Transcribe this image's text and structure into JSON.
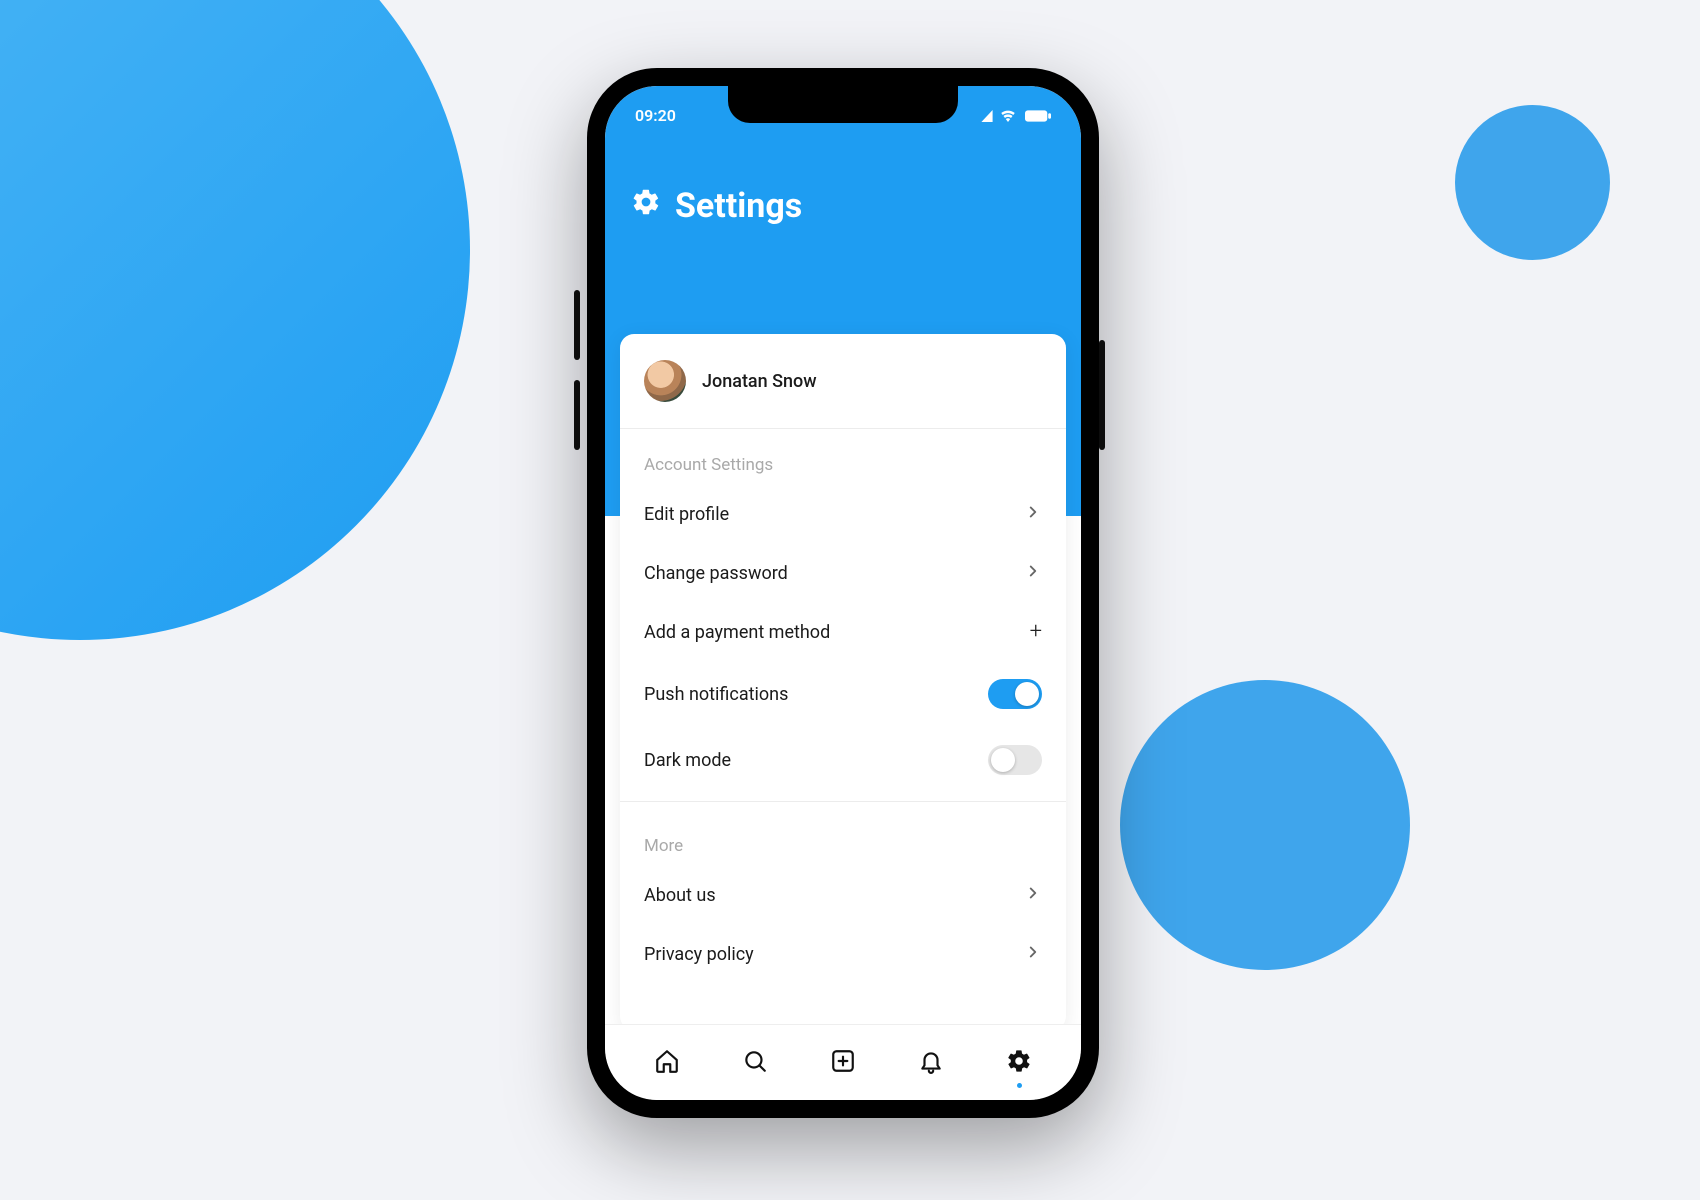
{
  "status": {
    "time": "09:20"
  },
  "page": {
    "title": "Settings"
  },
  "profile": {
    "name": "Jonatan Snow"
  },
  "sections": {
    "account": {
      "title": "Account Settings",
      "items": [
        {
          "label": "Edit profile"
        },
        {
          "label": "Change password"
        },
        {
          "label": "Add a payment method"
        },
        {
          "label": "Push notifications",
          "toggle_on": true
        },
        {
          "label": "Dark mode",
          "toggle_on": false
        }
      ]
    },
    "more": {
      "title": "More",
      "items": [
        {
          "label": "About us"
        },
        {
          "label": "Privacy policy"
        }
      ]
    }
  },
  "nav": {
    "items": [
      {
        "name": "home"
      },
      {
        "name": "search"
      },
      {
        "name": "add"
      },
      {
        "name": "notifications"
      },
      {
        "name": "settings",
        "active": true
      }
    ]
  },
  "colors": {
    "accent": "#1e9df2",
    "background": "#f2f3f7",
    "text": "#1b1b1b",
    "muted": "#a9a9a9"
  }
}
